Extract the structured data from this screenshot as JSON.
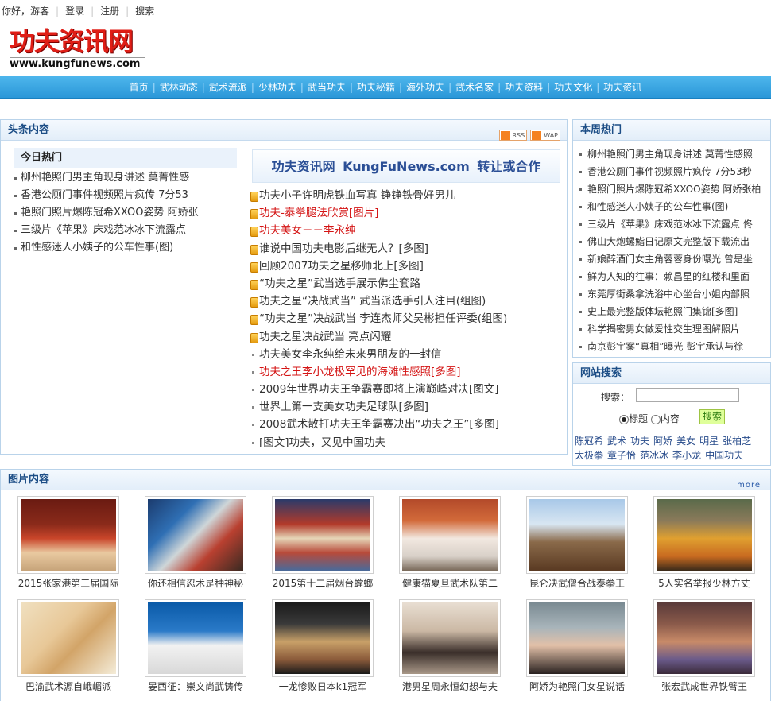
{
  "topbar": {
    "greeting": "你好，游客",
    "login": "登录",
    "register": "注册",
    "search": "搜索"
  },
  "logo": {
    "cn": "功夫资讯网",
    "en": "www.kungfunews.com"
  },
  "nav": [
    "首页",
    "武林动态",
    "武术流派",
    "少林功夫",
    "武当功夫",
    "功夫秘籍",
    "海外功夫",
    "武术名家",
    "功夫资料",
    "功夫文化",
    "功夫资讯"
  ],
  "headlines": {
    "title": "头条内容",
    "feeds": [
      "RSS",
      "WAP"
    ],
    "today_hot_title": "今日热门",
    "today_hot": [
      "柳州艳照门男主角现身讲述 莫菁性感",
      "香港公厕门事件视频照片疯传 7分53",
      "艳照门照片爆陈冠希XXOO姿势 阿娇张",
      "三级片《苹果》床戏范冰冰下流露点",
      "和性感迷人小姨子的公车性事(图)"
    ],
    "promo": [
      "功夫资讯网",
      "KungFuNews.com",
      "转让或合作"
    ],
    "news": [
      {
        "text": "功夫小子许明虎铁血写真 铮铮铁骨好男儿",
        "style": "lock"
      },
      {
        "text": "功夫-泰拳腿法欣赏[图片]",
        "style": "lock red"
      },
      {
        "text": "功夫美女－－李永纯",
        "style": "lock red"
      },
      {
        "text": "谁说中国功夫电影后继无人？[多图]",
        "style": "lock"
      },
      {
        "text": "回顾2007功夫之星移师北上[多图]",
        "style": "lock"
      },
      {
        "text": "“功夫之星”武当选手展示佛尘套路",
        "style": "lock"
      },
      {
        "text": "功夫之星“决战武当” 武当派选手引人注目(组图)",
        "style": "lock"
      },
      {
        "text": "“功夫之星”决战武当 李连杰师父吴彬担任评委(组图)",
        "style": "lock"
      },
      {
        "text": "功夫之星决战武当 亮点闪耀",
        "style": "lock"
      },
      {
        "text": "功夫美女李永纯给未来男朋友的一封信",
        "style": "plain"
      },
      {
        "text": "功夫之王李小龙极罕见的海滩性感照[多图]",
        "style": "plain red"
      },
      {
        "text": "2009年世界功夫王争霸赛即将上演巅峰对决[图文]",
        "style": "plain"
      },
      {
        "text": "世界上第一支美女功夫足球队[多图]",
        "style": "plain"
      },
      {
        "text": "2008武术散打功夫王争霸赛决出“功夫之王”[多图]",
        "style": "plain"
      },
      {
        "text": "[图文]功夫，又见中国功夫",
        "style": "plain"
      }
    ]
  },
  "weekly": {
    "title": "本周热门",
    "items": [
      "柳州艳照门男主角现身讲述 莫菁性感照",
      "香港公厕门事件视频照片疯传 7分53秒",
      "艳照门照片爆陈冠希XXOO姿势 阿娇张柏",
      "和性感迷人小姨子的公车性事(图)",
      "三级片《苹果》床戏范冰冰下流露点 佟",
      "佛山大炮螺鮨日记原文完整版下载流出",
      "新娘醉酒门女主角蓉蓉身份曝光 曾是坐",
      "鲜为人知的往事：赖昌星的红楼和里面",
      "东莞厚街桑拿洗浴中心坐台小姐内部照",
      "史上最完整版体坛艳照门集锦[多图]",
      "科学揭密男女做爱性交生理图解照片",
      "南京彭宇案“真相”曝光 彭宇承认与徐"
    ]
  },
  "site_search": {
    "title": "网站搜索",
    "label": "搜索：",
    "input_value": "",
    "options": [
      "标题",
      "内容"
    ],
    "selected": "标题",
    "button": "搜索",
    "tags": [
      "陈冠希",
      "武术",
      "功夫",
      "阿娇",
      "美女",
      "明星",
      "张柏芝",
      "太极拳",
      "章子怡",
      "范冰冰",
      "李小龙",
      "中国功夫"
    ]
  },
  "pictures": {
    "title": "图片内容",
    "more": "more",
    "items": [
      {
        "caption": "2015张家港第三届国际",
        "scene": "stadium-red"
      },
      {
        "caption": "你还相信忍术是种神秘",
        "scene": "ninja"
      },
      {
        "caption": "2015第十二届烟台螳螂",
        "scene": "stadium-flags"
      },
      {
        "caption": "健康猫夏旦武术队第二",
        "scene": "team"
      },
      {
        "caption": "昆仑决武僧合战泰拳王",
        "scene": "statue"
      },
      {
        "caption": "5人实名举报少林方丈",
        "scene": "monks"
      },
      {
        "caption": "巴渝武术源自峨嵋派",
        "scene": "map"
      },
      {
        "caption": "晏西征：崇文尚武铸传",
        "scene": "master"
      },
      {
        "caption": "一龙惨败日本k1冠军",
        "scene": "ring"
      },
      {
        "caption": "港男星周永恒幻想与夫",
        "scene": "couple"
      },
      {
        "caption": "阿娇为艳照门女星说话",
        "scene": "portrait"
      },
      {
        "caption": "张宏武成世界铁臂王",
        "scene": "crowd"
      }
    ]
  }
}
